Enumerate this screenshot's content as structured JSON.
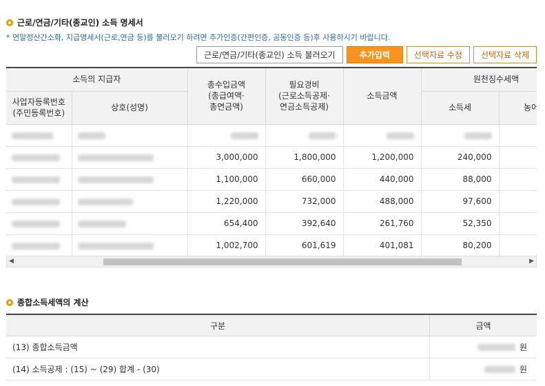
{
  "section1": {
    "title": "근로/연금/기타(종교인) 소득 명세서",
    "notice": "* 연말정산간소화, 지급명세서(근로,연금 등)를 불러오기 하려면 추가인증(간편인증, 공동인증 등)후 사용하시기 바랍니다."
  },
  "buttons": {
    "load": "근로/연금/기타(종교인) 소득 불러오기",
    "add": "추가입력",
    "edit": "선택자료 수정",
    "delete": "선택자료 삭제"
  },
  "table": {
    "headers": {
      "payer_group": "소득의 지급자",
      "bizno": "사업자등록번호\n(주민등록번호)",
      "name": "상호(성명)",
      "gross": "총수입금액\n(총급여액·\n총연금액)",
      "expense": "필요경비\n(근로소득공제·\n연금소득공제)",
      "income": "소득금액",
      "withholding_group": "원천징수세액",
      "income_tax": "소득세",
      "rural_tax": "농어촌"
    },
    "rows": [
      {
        "gross": "",
        "expense": "",
        "income": "",
        "tax": ""
      },
      {
        "gross": "3,000,000",
        "expense": "1,800,000",
        "income": "1,200,000",
        "tax": "240,000"
      },
      {
        "gross": "1,100,000",
        "expense": "660,000",
        "income": "440,000",
        "tax": "88,000"
      },
      {
        "gross": "1,220,000",
        "expense": "732,000",
        "income": "488,000",
        "tax": "97,600"
      },
      {
        "gross": "654,400",
        "expense": "392,640",
        "income": "261,760",
        "tax": "52,350"
      },
      {
        "gross": "1,002,700",
        "expense": "601,619",
        "income": "401,081",
        "tax": "80,200"
      }
    ]
  },
  "section2": {
    "title": "종합소득세액의 계산",
    "col_category": "구분",
    "col_amount": "금액",
    "rows": [
      {
        "label": "(13) 종합소득금액",
        "unit": "원"
      },
      {
        "label": "(14) 소득공제 : (15) ~ (29) 합계 - (30)",
        "unit": "원"
      }
    ]
  },
  "icons": {
    "bullet": "orange-circle-bullet-icon",
    "scroll_left": "arrow-left-icon",
    "scroll_right": "arrow-right-icon"
  },
  "colors": {
    "accent": "#f7931e",
    "notice": "#2b6cb0",
    "outline": "#e28a2b"
  }
}
